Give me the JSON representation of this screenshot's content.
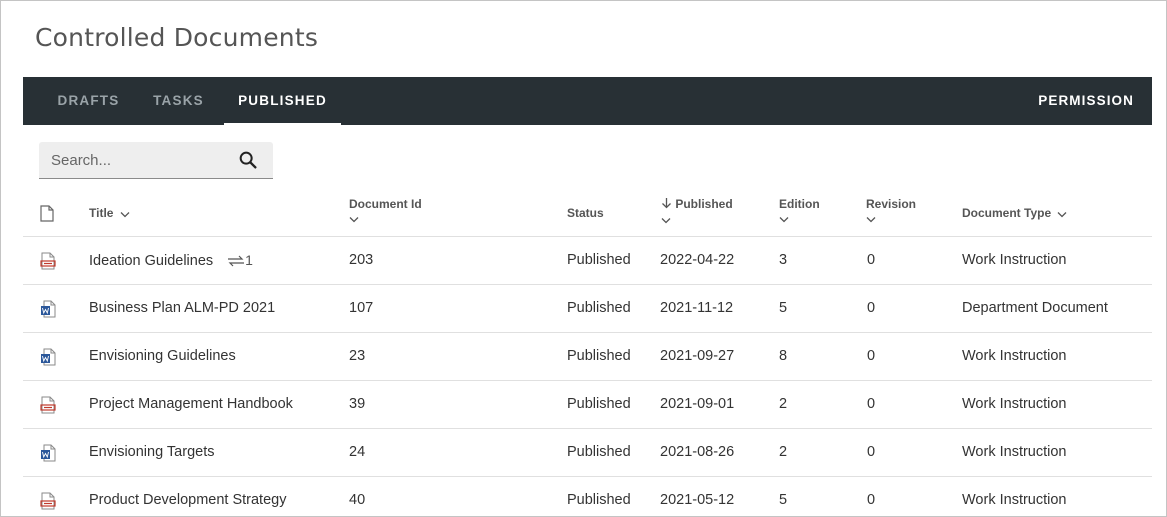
{
  "page": {
    "title": "Controlled Documents"
  },
  "tabs": [
    {
      "label": "DRAFTS",
      "active": false
    },
    {
      "label": "TASKS",
      "active": false
    },
    {
      "label": "PUBLISHED",
      "active": true
    }
  ],
  "permission_label": "PERMISSION",
  "search": {
    "placeholder": "Search...",
    "icon": "search-icon"
  },
  "table": {
    "columns": {
      "title": "Title",
      "document_id": "Document Id",
      "status": "Status",
      "published": "Published",
      "edition": "Edition",
      "revision": "Revision",
      "document_type": "Document Type"
    },
    "rows": [
      {
        "file_type": "pdf",
        "title": "Ideation Guidelines",
        "link_count": "1",
        "document_id": "203",
        "status": "Published",
        "published": "2022-04-22",
        "edition": "3",
        "revision": "0",
        "document_type": "Work Instruction"
      },
      {
        "file_type": "word",
        "title": "Business Plan ALM-PD 2021",
        "document_id": "107",
        "status": "Published",
        "published": "2021-11-12",
        "edition": "5",
        "revision": "0",
        "document_type": "Department Document"
      },
      {
        "file_type": "word",
        "title": "Envisioning Guidelines",
        "document_id": "23",
        "status": "Published",
        "published": "2021-09-27",
        "edition": "8",
        "revision": "0",
        "document_type": "Work Instruction"
      },
      {
        "file_type": "pdf",
        "title": "Project Management Handbook",
        "document_id": "39",
        "status": "Published",
        "published": "2021-09-01",
        "edition": "2",
        "revision": "0",
        "document_type": "Work Instruction"
      },
      {
        "file_type": "word",
        "title": "Envisioning Targets",
        "document_id": "24",
        "status": "Published",
        "published": "2021-08-26",
        "edition": "2",
        "revision": "0",
        "document_type": "Work Instruction"
      },
      {
        "file_type": "pdf",
        "title": "Product Development Strategy",
        "document_id": "40",
        "status": "Published",
        "published": "2021-05-12",
        "edition": "5",
        "revision": "0",
        "document_type": "Work Instruction"
      }
    ]
  },
  "colors": {
    "tabbar": "#283035",
    "pdf_icon": "#c0392b",
    "word_icon": "#2b579a"
  }
}
